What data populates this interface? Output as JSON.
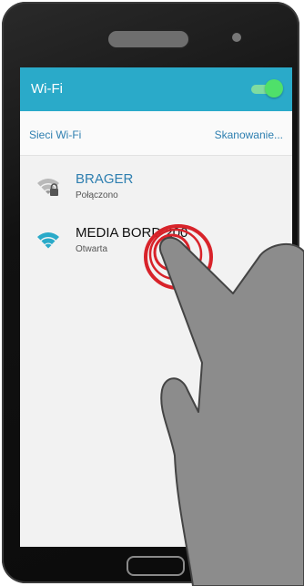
{
  "appbar": {
    "title": "Wi-Fi",
    "toggle_on": true
  },
  "section": {
    "title": "Sieci Wi-Fi",
    "scan_label": "Skanowanie..."
  },
  "networks": [
    {
      "name": "BRAGER",
      "status": "Połączono",
      "icon": "wifi-lock-icon",
      "name_color": "#2e7fb0"
    },
    {
      "name": "MEDIA BORD 200",
      "status": "Otwarta",
      "icon": "wifi-icon",
      "name_color": "#111111"
    }
  ],
  "colors": {
    "accent": "#2aaac9",
    "toggle": "#4fe06a",
    "link": "#2e7fb0",
    "tap_ring": "#d8232a"
  }
}
